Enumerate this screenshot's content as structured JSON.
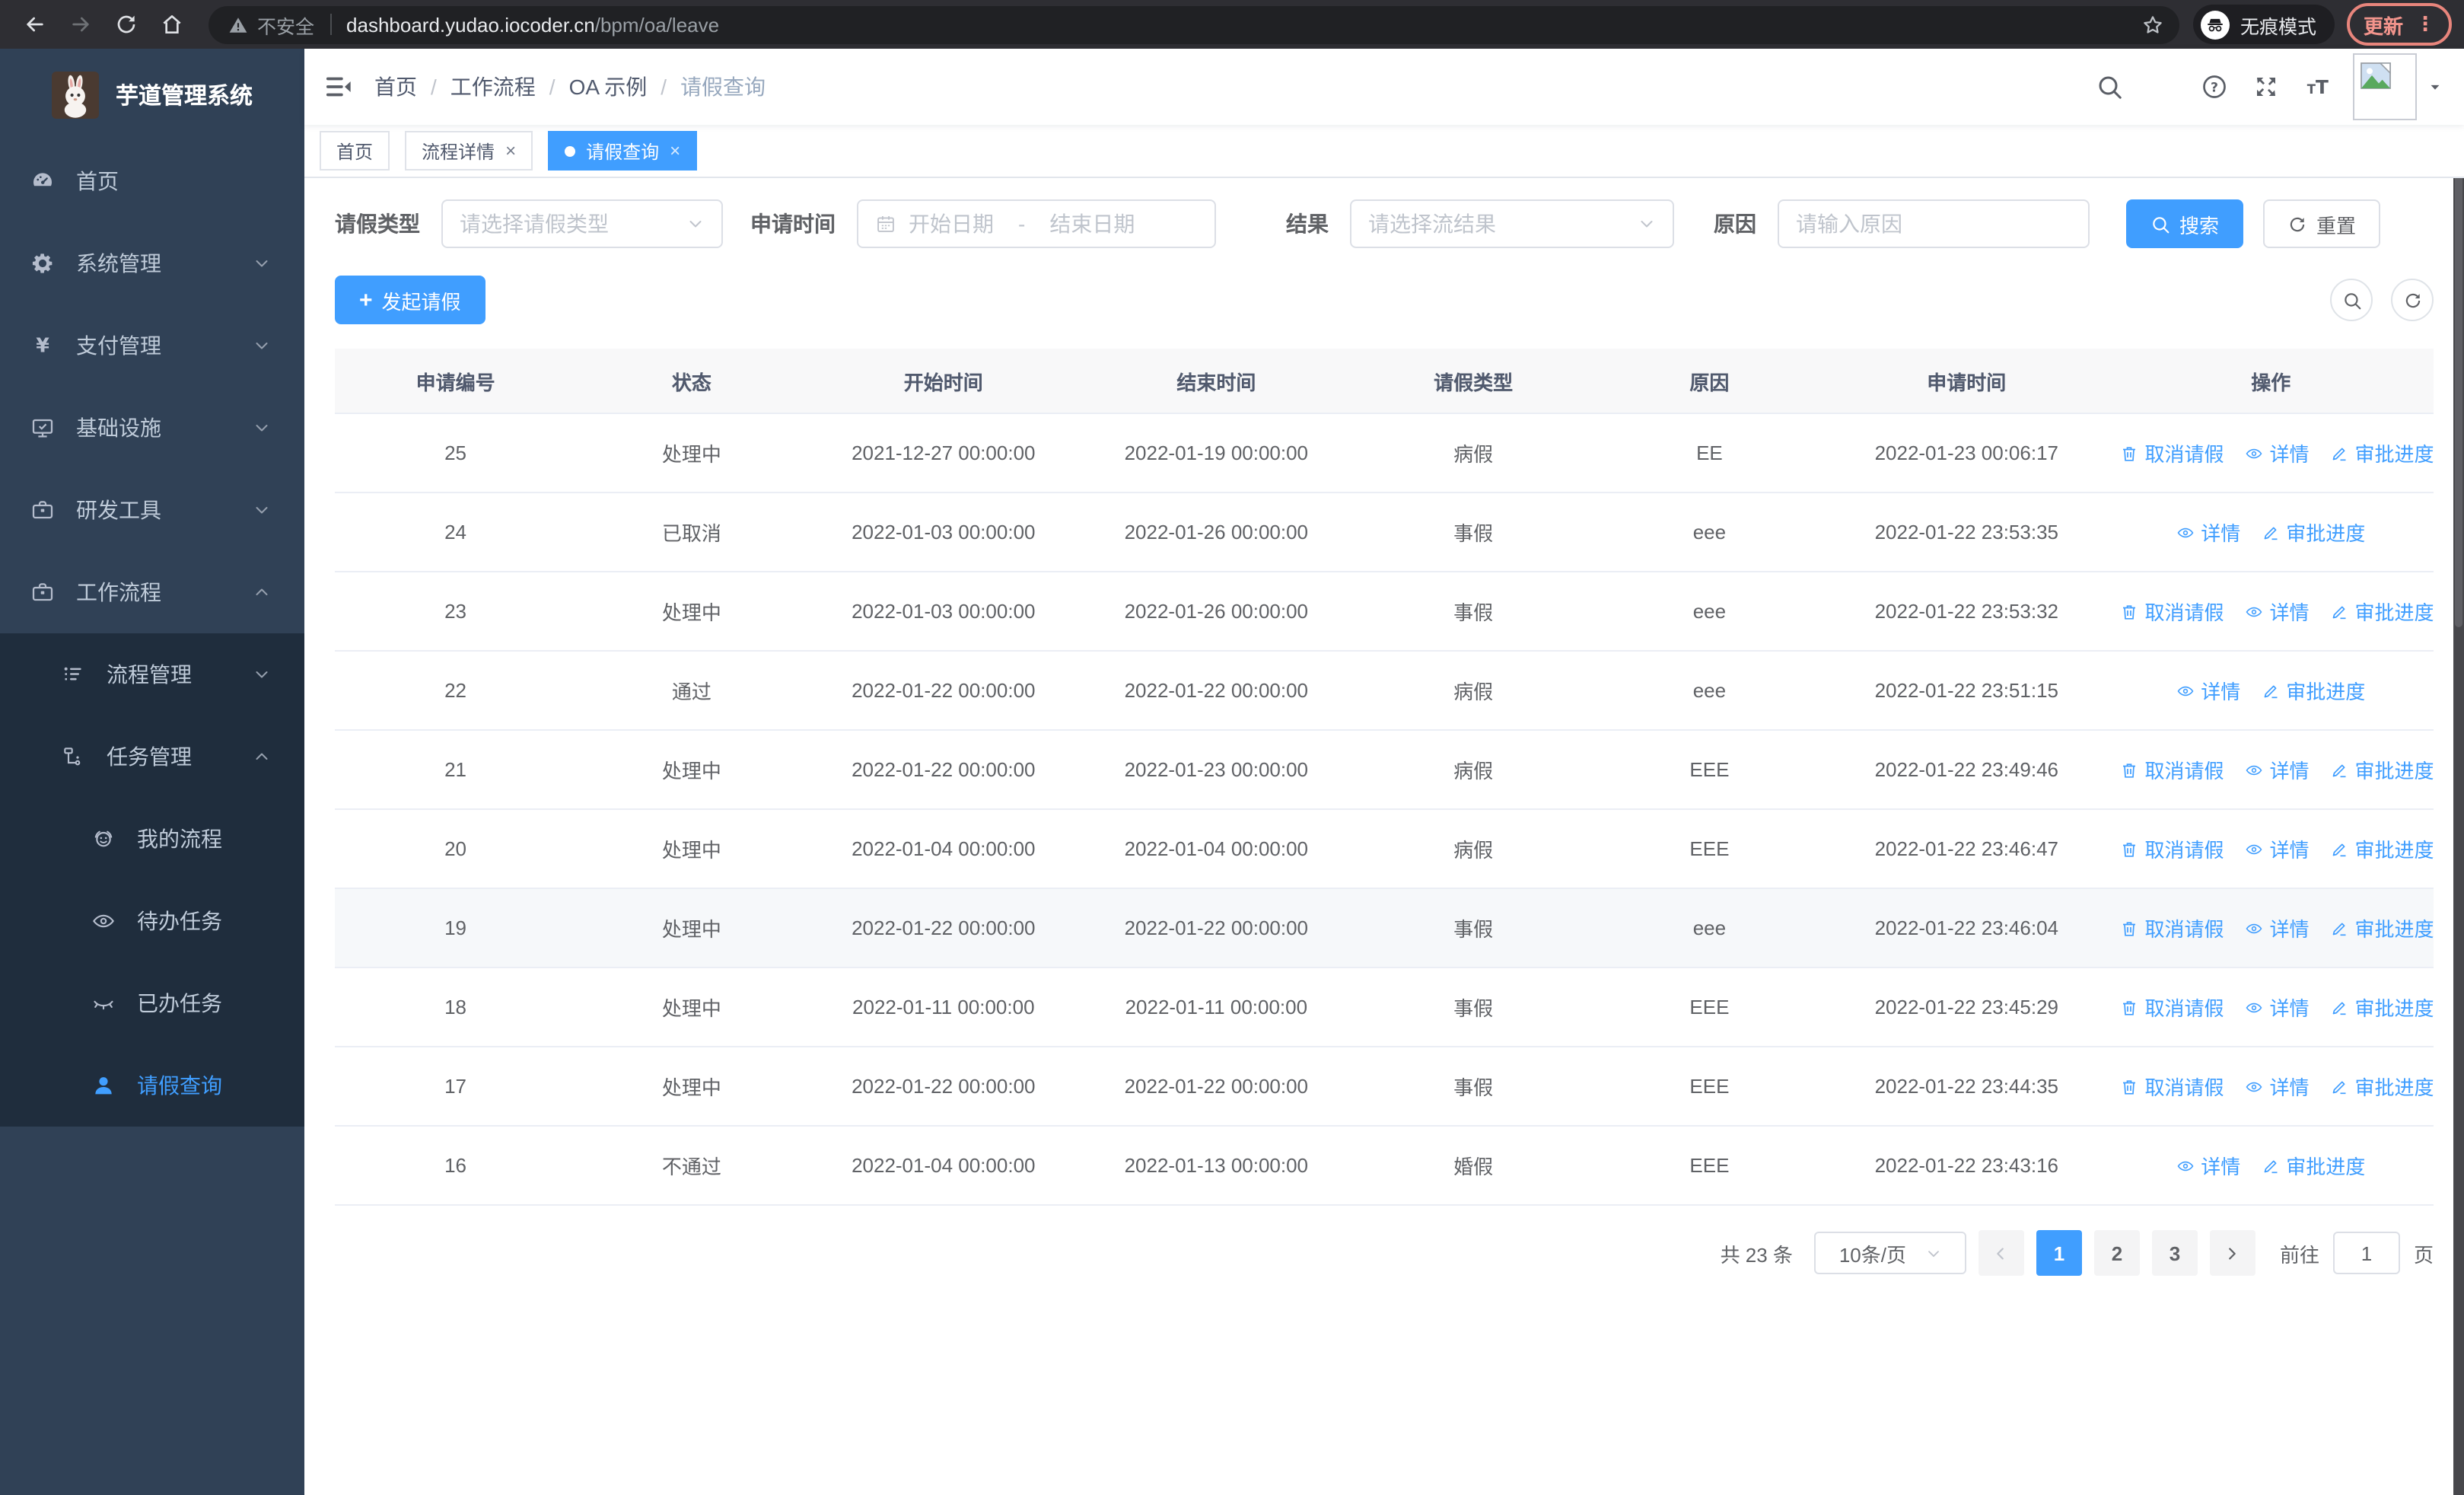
{
  "browser": {
    "security_label": "不安全",
    "url_host": "dashboard.yudao.iocoder.cn",
    "url_path": "/bpm/oa/leave",
    "incognito_label": "无痕模式",
    "update_label": "更新"
  },
  "sidebar": {
    "app_title": "芋道管理系统",
    "items": [
      {
        "id": "home",
        "label": "首页",
        "icon": "dashboard",
        "level": 1
      },
      {
        "id": "system",
        "label": "系统管理",
        "icon": "gear",
        "level": 1,
        "arrow": "down"
      },
      {
        "id": "payment",
        "label": "支付管理",
        "icon": "yen",
        "level": 1,
        "arrow": "down"
      },
      {
        "id": "infrastructure",
        "label": "基础设施",
        "icon": "monitor",
        "level": 1,
        "arrow": "down"
      },
      {
        "id": "dev-tools",
        "label": "研发工具",
        "icon": "briefcase",
        "level": 1,
        "arrow": "down"
      },
      {
        "id": "workflow",
        "label": "工作流程",
        "icon": "briefcase",
        "level": 1,
        "arrow": "up"
      },
      {
        "id": "process-mgmt",
        "label": "流程管理",
        "icon": "list",
        "level": 2,
        "sub": true,
        "arrow": "down"
      },
      {
        "id": "task-mgmt",
        "label": "任务管理",
        "icon": "tree",
        "level": 2,
        "sub": true,
        "arrow": "up"
      },
      {
        "id": "my-process",
        "label": "我的流程",
        "icon": "robot",
        "level": 3,
        "sub": true
      },
      {
        "id": "todo-tasks",
        "label": "待办任务",
        "icon": "eye",
        "level": 3,
        "sub": true
      },
      {
        "id": "done-tasks",
        "label": "已办任务",
        "icon": "eye-off",
        "level": 3,
        "sub": true
      },
      {
        "id": "leave-query",
        "label": "请假查询",
        "icon": "user",
        "level": 3,
        "sub": true,
        "active": true
      }
    ]
  },
  "header": {
    "breadcrumb": [
      "首页",
      "工作流程",
      "OA 示例",
      "请假查询"
    ]
  },
  "tabs": [
    {
      "label": "首页",
      "closable": false,
      "active": false
    },
    {
      "label": "流程详情",
      "closable": true,
      "active": false
    },
    {
      "label": "请假查询",
      "closable": true,
      "active": true
    }
  ],
  "filters": {
    "leave_type_label": "请假类型",
    "leave_type_placeholder": "请选择请假类型",
    "apply_time_label": "申请时间",
    "start_date_placeholder": "开始日期",
    "range_separator": "-",
    "end_date_placeholder": "结束日期",
    "result_label": "结果",
    "result_placeholder": "请选择流结果",
    "reason_label": "原因",
    "reason_placeholder": "请输入原因",
    "search_label": "搜索",
    "reset_label": "重置"
  },
  "toolbar": {
    "create_label": "发起请假"
  },
  "table": {
    "columns": [
      "申请编号",
      "状态",
      "开始时间",
      "结束时间",
      "请假类型",
      "原因",
      "申请时间",
      "操作"
    ],
    "action_labels": {
      "cancel": "取消请假",
      "detail": "详情",
      "progress": "审批进度"
    },
    "rows": [
      {
        "id": "25",
        "status": "处理中",
        "start": "2021-12-27 00:00:00",
        "end": "2022-01-19 00:00:00",
        "type": "病假",
        "reason": "EE",
        "applied": "2022-01-23 00:06:17",
        "actions": [
          "cancel",
          "detail",
          "progress"
        ]
      },
      {
        "id": "24",
        "status": "已取消",
        "start": "2022-01-03 00:00:00",
        "end": "2022-01-26 00:00:00",
        "type": "事假",
        "reason": "eee",
        "applied": "2022-01-22 23:53:35",
        "actions": [
          "detail",
          "progress"
        ]
      },
      {
        "id": "23",
        "status": "处理中",
        "start": "2022-01-03 00:00:00",
        "end": "2022-01-26 00:00:00",
        "type": "事假",
        "reason": "eee",
        "applied": "2022-01-22 23:53:32",
        "actions": [
          "cancel",
          "detail",
          "progress"
        ]
      },
      {
        "id": "22",
        "status": "通过",
        "start": "2022-01-22 00:00:00",
        "end": "2022-01-22 00:00:00",
        "type": "病假",
        "reason": "eee",
        "applied": "2022-01-22 23:51:15",
        "actions": [
          "detail",
          "progress"
        ]
      },
      {
        "id": "21",
        "status": "处理中",
        "start": "2022-01-22 00:00:00",
        "end": "2022-01-23 00:00:00",
        "type": "病假",
        "reason": "EEE",
        "applied": "2022-01-22 23:49:46",
        "actions": [
          "cancel",
          "detail",
          "progress"
        ]
      },
      {
        "id": "20",
        "status": "处理中",
        "start": "2022-01-04 00:00:00",
        "end": "2022-01-04 00:00:00",
        "type": "病假",
        "reason": "EEE",
        "applied": "2022-01-22 23:46:47",
        "actions": [
          "cancel",
          "detail",
          "progress"
        ]
      },
      {
        "id": "19",
        "status": "处理中",
        "start": "2022-01-22 00:00:00",
        "end": "2022-01-22 00:00:00",
        "type": "事假",
        "reason": "eee",
        "applied": "2022-01-22 23:46:04",
        "actions": [
          "cancel",
          "detail",
          "progress"
        ],
        "highlighted": true
      },
      {
        "id": "18",
        "status": "处理中",
        "start": "2022-01-11 00:00:00",
        "end": "2022-01-11 00:00:00",
        "type": "事假",
        "reason": "EEE",
        "applied": "2022-01-22 23:45:29",
        "actions": [
          "cancel",
          "detail",
          "progress"
        ]
      },
      {
        "id": "17",
        "status": "处理中",
        "start": "2022-01-22 00:00:00",
        "end": "2022-01-22 00:00:00",
        "type": "事假",
        "reason": "EEE",
        "applied": "2022-01-22 23:44:35",
        "actions": [
          "cancel",
          "detail",
          "progress"
        ]
      },
      {
        "id": "16",
        "status": "不通过",
        "start": "2022-01-04 00:00:00",
        "end": "2022-01-13 00:00:00",
        "type": "婚假",
        "reason": "EEE",
        "applied": "2022-01-22 23:43:16",
        "actions": [
          "detail",
          "progress"
        ]
      }
    ]
  },
  "pagination": {
    "total_label": "共 23 条",
    "page_size_label": "10条/页",
    "pages": [
      "1",
      "2",
      "3"
    ],
    "active_page": "1",
    "goto_label": "前往",
    "goto_value": "1",
    "goto_suffix": "页"
  },
  "colors": {
    "primary": "#409eff",
    "sidebar_bg": "#304156",
    "submenu_bg": "#1f2d3d",
    "menu_text": "#bfcbd9",
    "table_link": "#409eff",
    "active_tab_bg": "#409eff",
    "update_chip": "#f2948c",
    "table_header_bg": "#f8f8f9"
  }
}
